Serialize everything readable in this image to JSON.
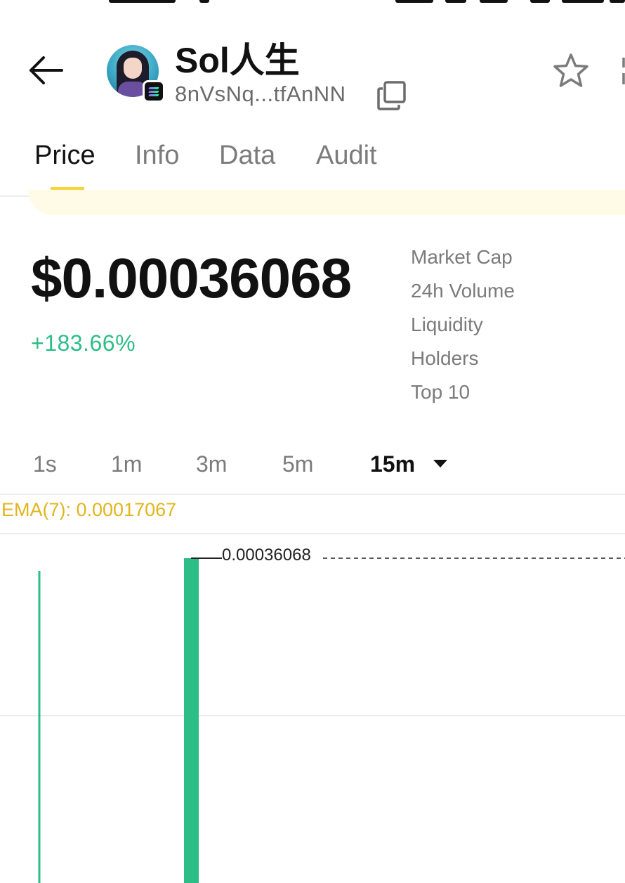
{
  "token": {
    "name": "Sol人生",
    "address": "8nVsNq...tfAnNN"
  },
  "tabs": [
    {
      "label": "Price"
    },
    {
      "label": "Info"
    },
    {
      "label": "Data"
    },
    {
      "label": "Audit"
    }
  ],
  "price": {
    "value": "$0.00036068",
    "change": "+183.66%"
  },
  "stats": {
    "market_cap_label": "Market Cap",
    "volume_label": "24h Volume",
    "liquidity_label": "Liquidity",
    "holders_label": "Holders",
    "top10_label": "Top 10"
  },
  "intervals": [
    {
      "label": "1s"
    },
    {
      "label": "1m"
    },
    {
      "label": "3m"
    },
    {
      "label": "5m"
    },
    {
      "label": "15m"
    }
  ],
  "selected_interval": "15m",
  "ema": {
    "label": "EMA(7): 0.00017067"
  },
  "colors": {
    "up": "#2dbd87",
    "accent": "#f7d33c",
    "ema": "#e2b41d"
  },
  "chart_data": {
    "type": "candlestick",
    "current_price_label": "0.00036068",
    "current_price": 0.00036068,
    "ema_7": 0.00017067
  }
}
